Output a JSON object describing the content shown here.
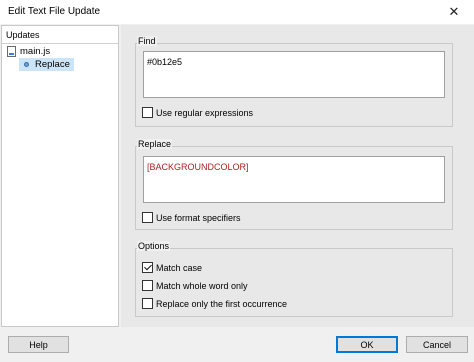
{
  "window": {
    "title": "Edit Text File Update",
    "close_glyph": "✕"
  },
  "tree": {
    "header": "Updates",
    "file": {
      "label": "main.js",
      "icon": "js-file-icon"
    },
    "child": {
      "label": "Replace",
      "selected": true
    }
  },
  "find": {
    "legend": "Find",
    "value": "#0b12e5",
    "regex_label": "Use regular expressions",
    "regex_checked": false
  },
  "replace": {
    "legend": "Replace",
    "value": "[BACKGROUNDCOLOR]",
    "value_color": "#b22222",
    "format_label": "Use format specifiers",
    "format_checked": false
  },
  "options": {
    "legend": "Options",
    "match_case_label": "Match case",
    "match_case_checked": true,
    "whole_word_label": "Match whole word only",
    "whole_word_checked": false,
    "first_only_label": "Replace only the first occurrence",
    "first_only_checked": false
  },
  "buttons": {
    "help": "Help",
    "ok": "OK",
    "cancel": "Cancel"
  },
  "colors": {
    "selection": "#cce4f7",
    "default_button_border": "#0078d7"
  }
}
